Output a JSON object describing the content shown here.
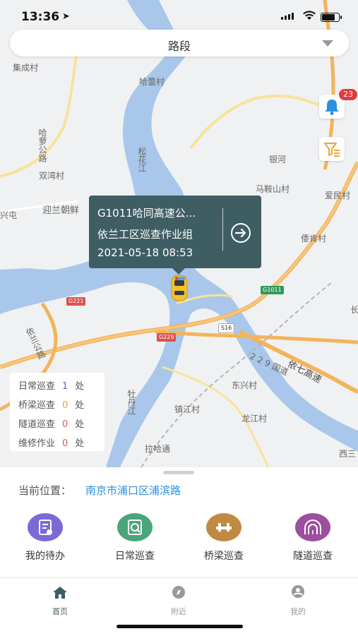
{
  "status_bar": {
    "time": "13:36"
  },
  "route_selector": {
    "label": "路段"
  },
  "notifications": {
    "badge_count": "23"
  },
  "map_labels": [
    {
      "key": "jicheng",
      "text": "集成村"
    },
    {
      "key": "halei",
      "text": "哈蕾村"
    },
    {
      "key": "haluo_road",
      "text": "哈萝公路"
    },
    {
      "key": "shuangwan",
      "text": "双湾村"
    },
    {
      "key": "songhua",
      "text": "松花江"
    },
    {
      "key": "yinhe",
      "text": "银河"
    },
    {
      "key": "maanshan",
      "text": "马鞍山村"
    },
    {
      "key": "aimin",
      "text": "爱民村"
    },
    {
      "key": "yingbin",
      "text": "迎兰朝鲜"
    },
    {
      "key": "xingtun",
      "text": "兴屯"
    },
    {
      "key": "jiaoxiao",
      "text": "倭肯村"
    },
    {
      "key": "yilan_road",
      "text": "依兰公路"
    },
    {
      "key": "dongxing",
      "text": "东兴村"
    },
    {
      "key": "zhenjiang",
      "text": "镇江村"
    },
    {
      "key": "longjiang",
      "text": "龙江村"
    },
    {
      "key": "mudan",
      "text": "牡丹江"
    },
    {
      "key": "lahatong",
      "text": "拉哈通"
    },
    {
      "key": "xisan",
      "text": "西三"
    },
    {
      "key": "guodao229",
      "text": "2 2 9 国道"
    },
    {
      "key": "yiqi",
      "text": "依七高速"
    },
    {
      "key": "zhang",
      "text": "长"
    }
  ],
  "road_badges": {
    "g221": "G221",
    "g229": "G229",
    "g1011": "G1011",
    "s16": "S16"
  },
  "popup": {
    "line1": "G1011哈同高速公...",
    "line2": "依兰工区巡查作业组",
    "line3": "2021-05-18 08:53"
  },
  "legend": {
    "rows": [
      {
        "label": "日常巡查",
        "count": "1",
        "unit": "处",
        "color": "#8a4fd0"
      },
      {
        "label": "桥梁巡查",
        "count": "0",
        "unit": "处",
        "color": "#e8a23a"
      },
      {
        "label": "隧道巡查",
        "count": "0",
        "unit": "处",
        "color": "#e05a5a"
      },
      {
        "label": "维修作业",
        "count": "0",
        "unit": "处",
        "color": "#e05a5a"
      }
    ]
  },
  "location": {
    "label": "当前位置：",
    "value": "南京市浦口区浦滨路"
  },
  "actions": [
    {
      "label": "我的待办",
      "icon": "todo-icon",
      "color": "#7b6ad6"
    },
    {
      "label": "日常巡查",
      "icon": "daily-inspection-icon",
      "color": "#4aa57a"
    },
    {
      "label": "桥梁巡查",
      "icon": "bridge-icon",
      "color": "#c08a44"
    },
    {
      "label": "隧道巡查",
      "icon": "tunnel-icon",
      "color": "#9b4f9d"
    }
  ],
  "tabs": [
    {
      "label": "首页",
      "icon": "home-icon",
      "active": true
    },
    {
      "label": "附近",
      "icon": "compass-icon",
      "active": false
    },
    {
      "label": "我的",
      "icon": "user-icon",
      "active": false
    }
  ],
  "colors": {
    "accent": "#2b8fe0",
    "popup_bg": "#3f5e63",
    "active_tab": "#3f5e63",
    "inactive_tab": "#999999"
  }
}
